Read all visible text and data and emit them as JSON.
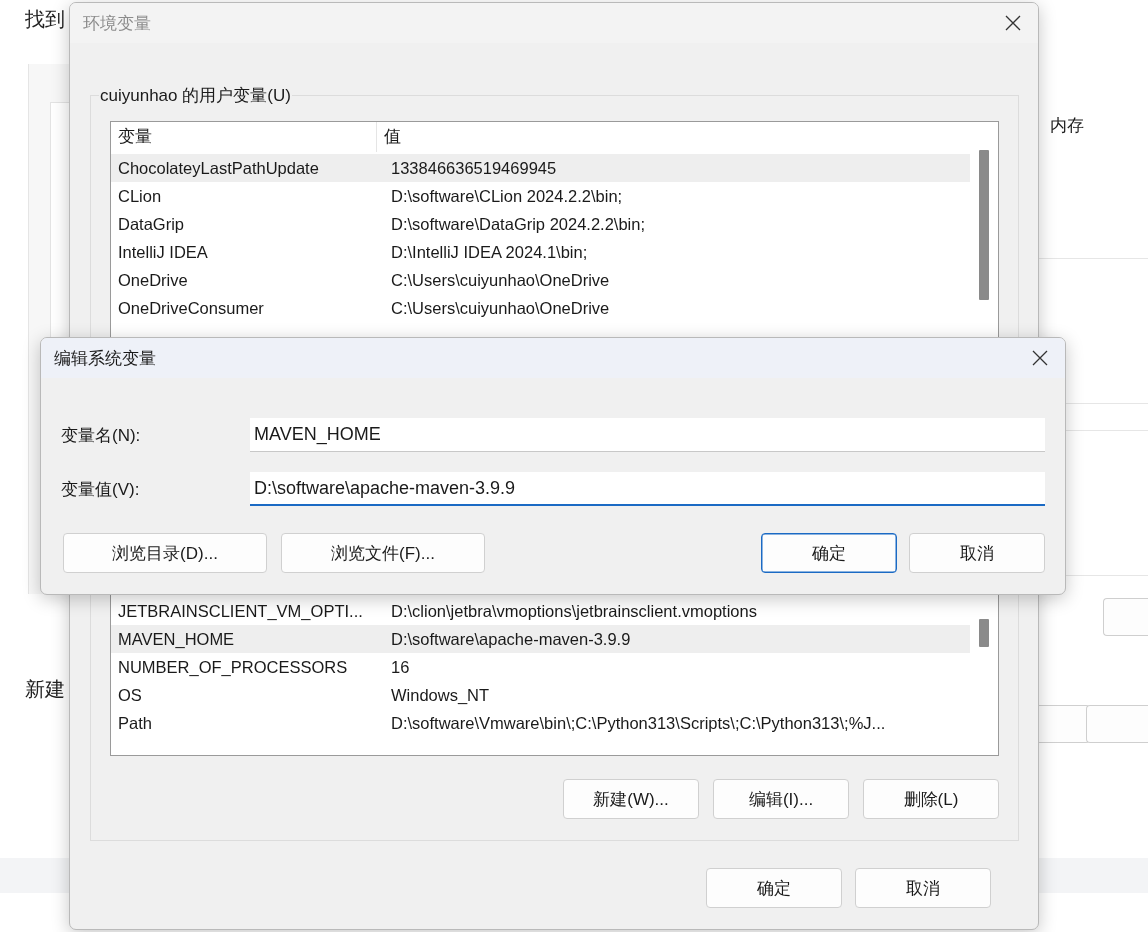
{
  "background_page": {
    "heading": "找到",
    "memory_text": "内存",
    "new_heading": "新建"
  },
  "environment_window": {
    "title": "环境变量",
    "active": false,
    "user_variables": {
      "label": "cuiyunhao 的用户变量(U)",
      "columns": [
        "变量",
        "值"
      ],
      "rows": [
        {
          "name": "ChocolateyLastPathUpdate",
          "value": "133846636519469945",
          "selected": true
        },
        {
          "name": "CLion",
          "value": "D:\\software\\CLion 2024.2.2\\bin;",
          "selected": false
        },
        {
          "name": "DataGrip",
          "value": "D:\\software\\DataGrip 2024.2.2\\bin;",
          "selected": false
        },
        {
          "name": "IntelliJ IDEA",
          "value": "D:\\IntelliJ IDEA 2024.1\\bin;",
          "selected": false
        },
        {
          "name": "OneDrive",
          "value": "C:\\Users\\cuiyunhao\\OneDrive",
          "selected": false
        },
        {
          "name": "OneDriveConsumer",
          "value": "C:\\Users\\cuiyunhao\\OneDrive",
          "selected": false
        }
      ]
    },
    "system_variables": {
      "rows": [
        {
          "name": "JETBRAINSCLIENT_VM_OPTI...",
          "value": "D:\\clion\\jetbra\\vmoptions\\jetbrainsclient.vmoptions",
          "selected": false
        },
        {
          "name": "MAVEN_HOME",
          "value": "D:\\software\\apache-maven-3.9.9",
          "selected": true
        },
        {
          "name": "NUMBER_OF_PROCESSORS",
          "value": "16",
          "selected": false
        },
        {
          "name": "OS",
          "value": "Windows_NT",
          "selected": false
        },
        {
          "name": "Path",
          "value": "D:\\software\\Vmware\\bin\\;C:\\Python313\\Scripts\\;C:\\Python313\\;%J...",
          "selected": false
        }
      ],
      "buttons": [
        "新建(W)...",
        "编辑(I)...",
        "删除(L)"
      ]
    },
    "buttons": [
      "确定",
      "取消"
    ]
  },
  "edit_dialog": {
    "title": "编辑系统变量",
    "active": true,
    "fields": [
      {
        "label": "变量名(N):",
        "value": "MAVEN_HOME",
        "focused": false
      },
      {
        "label": "变量值(V):",
        "value": "D:\\software\\apache-maven-3.9.9",
        "focused": true
      }
    ],
    "left_buttons": [
      {
        "label": "浏览目录(D)...",
        "default": false
      },
      {
        "label": "浏览文件(F)...",
        "default": false
      }
    ],
    "right_buttons": [
      {
        "label": "确定",
        "default": true
      },
      {
        "label": "取消",
        "default": false
      }
    ]
  }
}
